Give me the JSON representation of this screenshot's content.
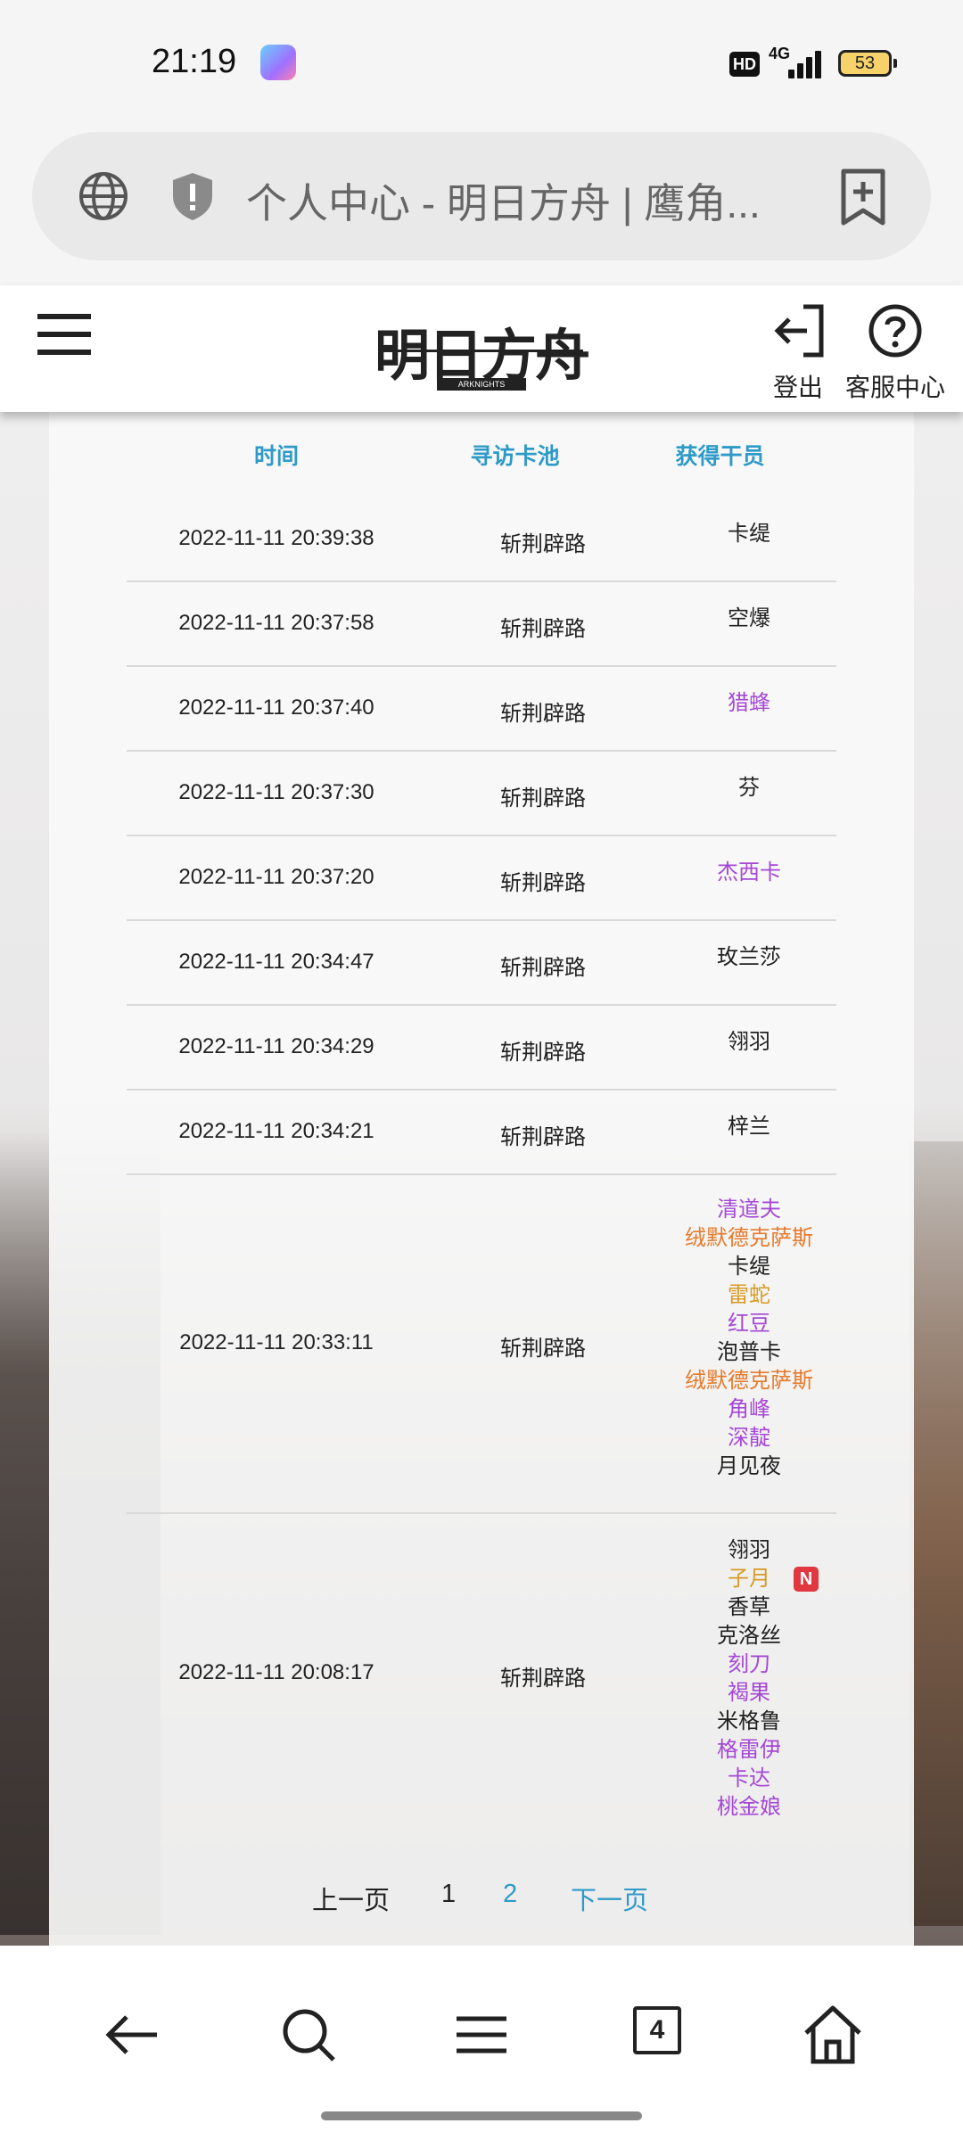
{
  "status_bar": {
    "time": "21:19",
    "hd_badge": "HD",
    "network": "4G",
    "battery": "53"
  },
  "browser": {
    "url_title": "个人中心 - 明日方舟 | 鹰角...",
    "icons": [
      "globe-icon",
      "shield-icon",
      "bookmark-add-icon"
    ]
  },
  "header": {
    "logo_text": "明日方舟",
    "logo_sub": "ARKNIGHTS",
    "logout_label": "登出",
    "help_label": "客服中心"
  },
  "table": {
    "headers": [
      "时间",
      "寻访卡池",
      "获得干员"
    ],
    "rows": [
      {
        "time": "2022-11-11 20:39:38",
        "pool": "斩荆辟路",
        "operators": [
          {
            "name": "卡缇",
            "rarity": 3
          }
        ]
      },
      {
        "time": "2022-11-11 20:37:58",
        "pool": "斩荆辟路",
        "operators": [
          {
            "name": "空爆",
            "rarity": 3
          }
        ]
      },
      {
        "time": "2022-11-11 20:37:40",
        "pool": "斩荆辟路",
        "operators": [
          {
            "name": "猎蜂",
            "rarity": 4
          }
        ]
      },
      {
        "time": "2022-11-11 20:37:30",
        "pool": "斩荆辟路",
        "operators": [
          {
            "name": "芬",
            "rarity": 3
          }
        ]
      },
      {
        "time": "2022-11-11 20:37:20",
        "pool": "斩荆辟路",
        "operators": [
          {
            "name": "杰西卡",
            "rarity": 4
          }
        ]
      },
      {
        "time": "2022-11-11 20:34:47",
        "pool": "斩荆辟路",
        "operators": [
          {
            "name": "玫兰莎",
            "rarity": 3
          }
        ]
      },
      {
        "time": "2022-11-11 20:34:29",
        "pool": "斩荆辟路",
        "operators": [
          {
            "name": "翎羽",
            "rarity": 3
          }
        ]
      },
      {
        "time": "2022-11-11 20:34:21",
        "pool": "斩荆辟路",
        "operators": [
          {
            "name": "梓兰",
            "rarity": 3
          }
        ]
      },
      {
        "time": "2022-11-11 20:33:11",
        "pool": "斩荆辟路",
        "operators": [
          {
            "name": "清道夫",
            "rarity": 4
          },
          {
            "name": "绒默德克萨斯",
            "rarity": 6
          },
          {
            "name": "卡缇",
            "rarity": 3
          },
          {
            "name": "雷蛇",
            "rarity": 5
          },
          {
            "name": "红豆",
            "rarity": 4
          },
          {
            "name": "泡普卡",
            "rarity": 3
          },
          {
            "name": "绒默德克萨斯",
            "rarity": 6
          },
          {
            "name": "角峰",
            "rarity": 4
          },
          {
            "name": "深靛",
            "rarity": 4
          },
          {
            "name": "月见夜",
            "rarity": 3
          }
        ]
      },
      {
        "time": "2022-11-11 20:08:17",
        "pool": "斩荆辟路",
        "operators": [
          {
            "name": "翎羽",
            "rarity": 3
          },
          {
            "name": "子月",
            "rarity": 5,
            "badge": "N"
          },
          {
            "name": "香草",
            "rarity": 3
          },
          {
            "name": "克洛丝",
            "rarity": 3
          },
          {
            "name": "刻刀",
            "rarity": 4
          },
          {
            "name": "褐果",
            "rarity": 4
          },
          {
            "name": "米格鲁",
            "rarity": 3
          },
          {
            "name": "格雷伊",
            "rarity": 4
          },
          {
            "name": "卡达",
            "rarity": 4
          },
          {
            "name": "桃金娘",
            "rarity": 4
          }
        ]
      }
    ]
  },
  "pagination": {
    "prev_label": "上一页",
    "page1": "1",
    "page2": "2",
    "next_label": "下一页"
  },
  "bottom_nav": {
    "tab_count": "4",
    "icons": [
      "back-arrow-icon",
      "search-icon",
      "menu-icon",
      "tabs-icon",
      "home-icon"
    ]
  },
  "colors": {
    "header_blue": "#2e9ac8",
    "rarity3": "#222222",
    "rarity4": "#a448d6",
    "rarity5": "#d79a24",
    "rarity6": "#e67a2c",
    "badge_red": "#e0383e"
  }
}
